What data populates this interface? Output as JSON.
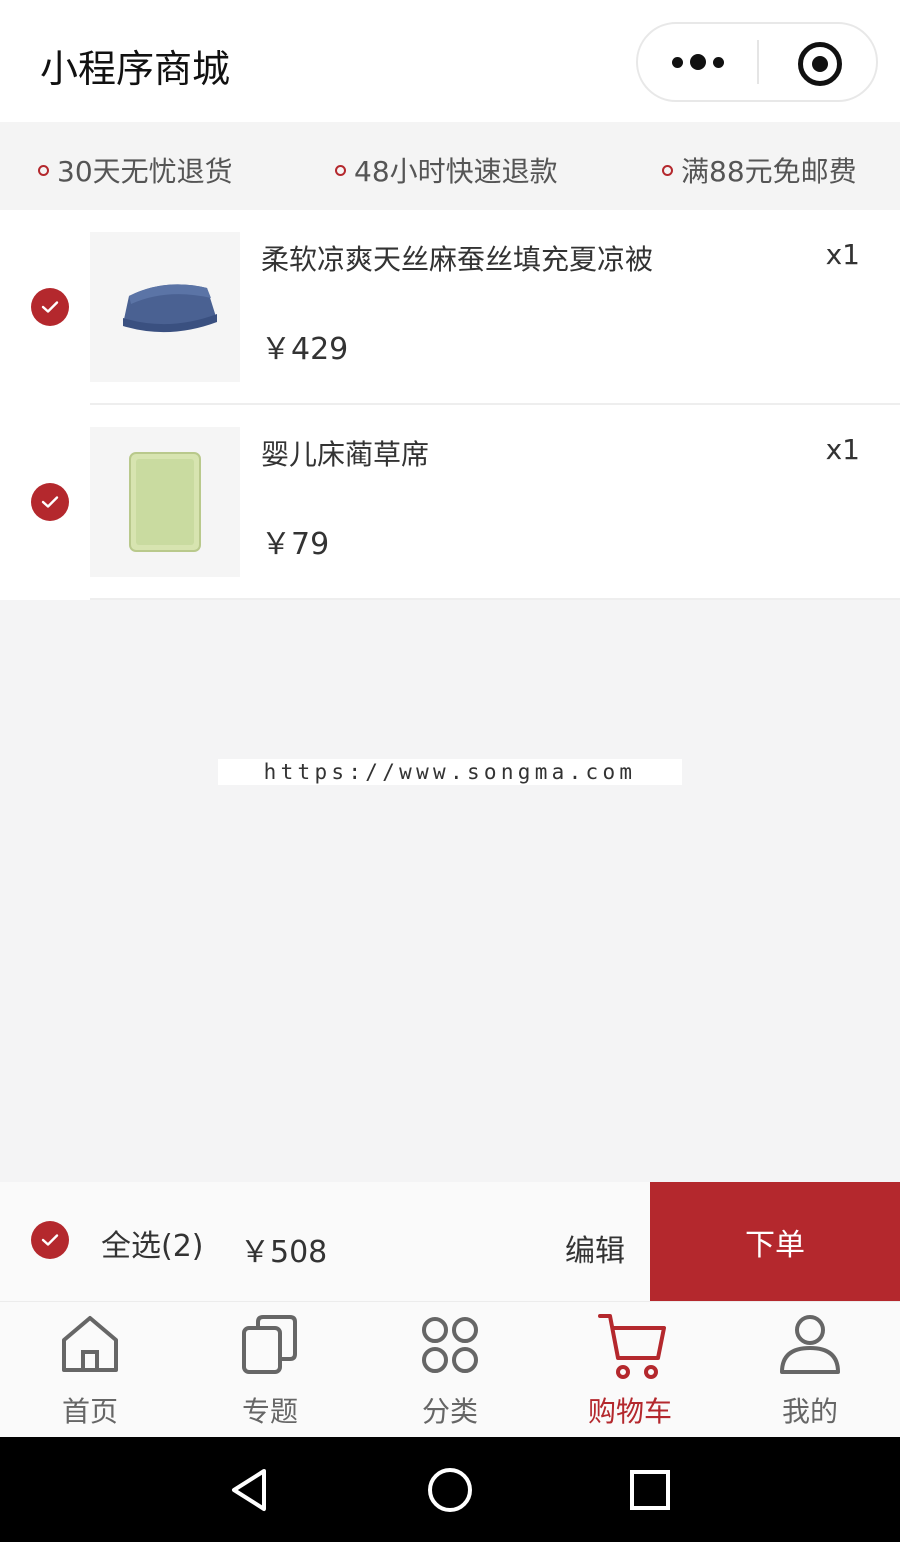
{
  "header": {
    "title": "小程序商城",
    "more_icon": "more-dots-icon",
    "close_icon": "target-circle-icon"
  },
  "promos": [
    {
      "text": "30天无忧退货"
    },
    {
      "text": "48小时快速退款"
    },
    {
      "text": "满88元免邮费"
    }
  ],
  "cart": {
    "items": [
      {
        "name": "柔软凉爽天丝麻蚕丝填充夏凉被",
        "price": "￥429",
        "qty": "x1",
        "checked": true
      },
      {
        "name": "婴儿床蔺草席",
        "price": "￥79",
        "qty": "x1",
        "checked": true
      }
    ]
  },
  "watermark": "https://www.songma.com",
  "checkout": {
    "select_all": "全选(2)",
    "total": "￥508",
    "edit": "编辑",
    "order": "下单"
  },
  "tabbar": [
    {
      "label": "首页",
      "icon": "home-icon",
      "active": false
    },
    {
      "label": "专题",
      "icon": "copy-icon",
      "active": false
    },
    {
      "label": "分类",
      "icon": "grid-circles-icon",
      "active": false
    },
    {
      "label": "购物车",
      "icon": "cart-icon",
      "active": true
    },
    {
      "label": "我的",
      "icon": "user-icon",
      "active": false
    }
  ],
  "colors": {
    "accent": "#b4282d",
    "background": "#f4f4f5"
  }
}
